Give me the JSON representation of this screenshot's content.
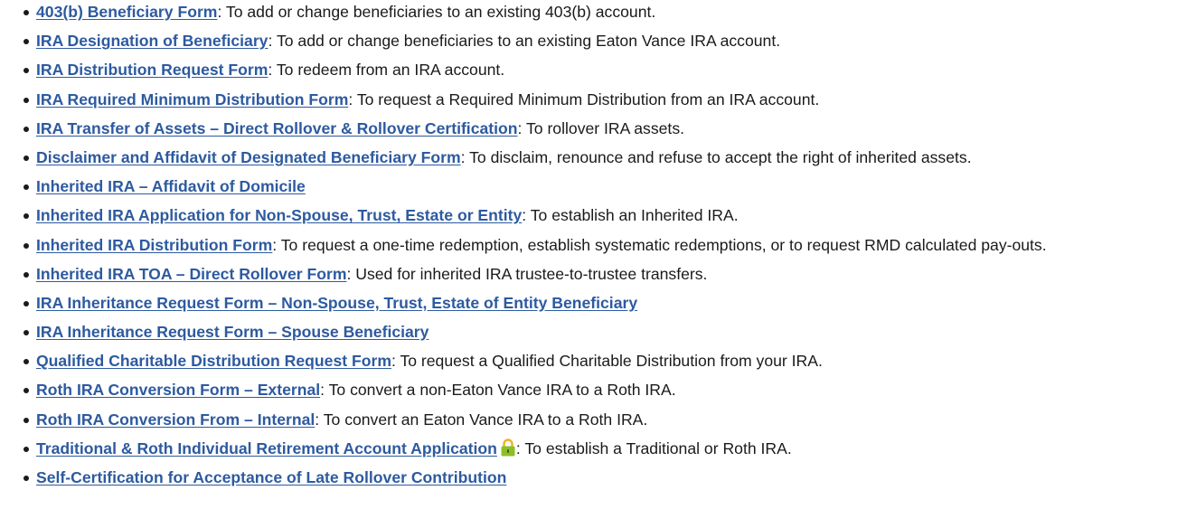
{
  "separator": ": ",
  "items": [
    {
      "link": "403(b) Beneficiary Form",
      "desc": "To add or change beneficiaries to an existing 403(b) account."
    },
    {
      "link": "IRA Designation of Beneficiary",
      "desc": "To add or change beneficiaries to an existing Eaton Vance IRA account."
    },
    {
      "link": "IRA Distribution Request Form",
      "desc": "To redeem from an IRA account."
    },
    {
      "link": "IRA Required Minimum Distribution Form",
      "desc": "To request a Required Minimum Distribution from an IRA account."
    },
    {
      "link": "IRA Transfer of Assets – Direct Rollover & Rollover Certification",
      "desc": "To rollover IRA assets."
    },
    {
      "link": "Disclaimer and Affidavit of Designated Beneficiary Form",
      "desc": "To disclaim, renounce and refuse to accept the right of inherited assets."
    },
    {
      "link": "Inherited IRA – Affidavit of Domicile",
      "desc": ""
    },
    {
      "link": "Inherited IRA Application for Non-Spouse, Trust, Estate or Entity",
      "desc": "To establish an Inherited IRA."
    },
    {
      "link": "Inherited IRA Distribution Form",
      "desc": "To request a one-time redemption, establish systematic redemptions, or to request RMD calculated pay-outs."
    },
    {
      "link": "Inherited IRA TOA – Direct Rollover Form",
      "desc": "Used for inherited IRA trustee-to-trustee transfers."
    },
    {
      "link": "IRA Inheritance Request Form – Non-Spouse, Trust, Estate of Entity Beneficiary",
      "desc": ""
    },
    {
      "link": "IRA Inheritance Request Form – Spouse Beneficiary",
      "desc": ""
    },
    {
      "link": "Qualified Charitable Distribution Request Form",
      "desc": "To request a Qualified Charitable Distribution from your IRA."
    },
    {
      "link": "Roth IRA Conversion Form – External",
      "desc": "To convert a non-Eaton Vance IRA to a Roth IRA."
    },
    {
      "link": "Roth IRA Conversion From – Internal",
      "desc": "To convert an Eaton Vance IRA to a Roth IRA."
    },
    {
      "link": "Traditional & Roth Individual Retirement Account Application",
      "desc": "To establish a Traditional or Roth IRA.",
      "lock": true
    },
    {
      "link": "Self-Certification for Acceptance of Late Rollover Contribution",
      "desc": ""
    }
  ],
  "colors": {
    "link": "#2d5aa0",
    "text": "#1a1a1a",
    "lock_body": "#8cbf26",
    "lock_shackle": "#f0b21e"
  },
  "icons": {
    "lock": "padlock-icon"
  }
}
